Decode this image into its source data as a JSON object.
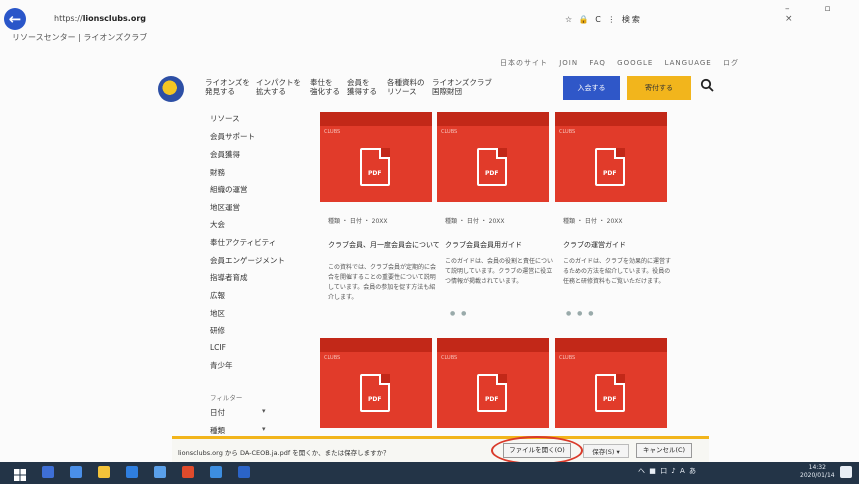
{
  "browser": {
    "url_prefix": "https://",
    "url_domain": "lionsclubs.org",
    "bookmark": "リソースセンター | ライオンズクラブ",
    "toolbar": "☆ 🔒 C ⋮ 検索"
  },
  "header": {
    "utility_links": [
      "日本のサイト",
      "JOIN",
      "FAQ",
      "GOOGLE",
      "LANGUAGE",
      "ログ"
    ],
    "nav": [
      {
        "line1": "ライオンズを",
        "line2": "発見する"
      },
      {
        "line1": "インパクトを",
        "line2": "拡大する"
      },
      {
        "line1": "奉仕を",
        "line2": "強化する"
      },
      {
        "line1": "会員を",
        "line2": "獲得する"
      },
      {
        "line1": "各種資料の",
        "line2": "リソース"
      },
      {
        "line1": "ライオンズクラブ",
        "line2": "国際財団"
      }
    ],
    "join_label": "入会する",
    "donate_label": "寄付する"
  },
  "sidebar": {
    "items": [
      "リソース",
      "会員サポート",
      "会員獲得",
      "財務",
      "組織の運営",
      "地区運営",
      "大会",
      "奉仕アクティビティ",
      "会員エンゲージメント",
      "指導者育成",
      "広報",
      "地区",
      "研修",
      "LCIF",
      "青少年"
    ],
    "section_label": "フィルター",
    "filters": [
      "日付",
      "種類"
    ]
  },
  "cards": [
    {
      "tag": "CLUBS",
      "pdf": "PDF",
      "meta": "種類 ・ 日付 ・ 20XX",
      "title": "クラブ会員、月一度会員会について",
      "body": "この資料では、クラブ会員が定期的に会合を開催することの重要性について説明しています。会員の参加を促す方法も紹介します。"
    },
    {
      "tag": "CLUBS",
      "pdf": "PDF",
      "meta": "種類 ・ 日付 ・ 20XX",
      "title": "クラブ会員会員用ガイド",
      "body": "このガイドは、会員の役割と責任について説明しています。クラブの運営に役立つ情報が掲載されています。"
    },
    {
      "tag": "CLUBS",
      "pdf": "PDF",
      "meta": "種類 ・ 日付 ・ 20XX",
      "title": "クラブの運営ガイド",
      "body": "このガイドは、クラブを効果的に運営するための方法を紹介しています。役員の任務と研修資料もご覧いただけます。"
    },
    {
      "tag": "CLUBS",
      "pdf": "PDF"
    },
    {
      "tag": "CLUBS",
      "pdf": "PDF"
    },
    {
      "tag": "CLUBS",
      "pdf": "PDF"
    }
  ],
  "download": {
    "message": "lionsclubs.org から DA-CEOB.ja.pdf を開くか、または保存しますか？",
    "open_label": "ファイルを開く(O)",
    "save_label": "保存(S)",
    "cancel_label": "キャンセル(C)"
  },
  "taskbar": {
    "tray": "へ ■ 口 ♪ A あ",
    "time": "14:32",
    "date": "2020/01/14"
  },
  "colors": {
    "accent_blue": "#2f57c8",
    "accent_gold": "#f2b51c",
    "card_red": "#e13b2a",
    "taskbar": "#233447"
  }
}
